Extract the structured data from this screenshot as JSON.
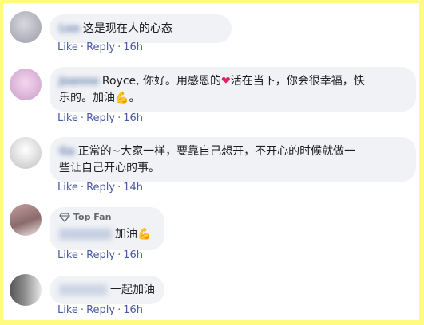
{
  "colors": {
    "border": "#fffb80",
    "link": "#4b5aa6",
    "bubble": "#f0f2f5",
    "name": "#385898"
  },
  "actions": {
    "like": "Like",
    "reply": "Reply",
    "dot": "·"
  },
  "comments": [
    {
      "name": "Lee",
      "text": "这是现在人的心态",
      "time": "16h"
    },
    {
      "name": "Joanne",
      "text_a": "Royce, 你好。用感恩的",
      "heart": "❤",
      "text_b": "活在当下，你会很幸福，快",
      "text_c": "乐的。加油",
      "muscle": "💪",
      "text_d": "。",
      "time": "16h"
    },
    {
      "name": "Ga",
      "text_a": "正常的~大家一样，要靠自己想开，不开心的时候就做一",
      "text_b": "些让自己开心的事。",
      "time": "14h"
    },
    {
      "badge": "Top Fan",
      "name": "",
      "text": "加油",
      "muscle": "💪",
      "time": "16h"
    },
    {
      "name": "",
      "text": "一起加油",
      "time": "16h"
    }
  ]
}
